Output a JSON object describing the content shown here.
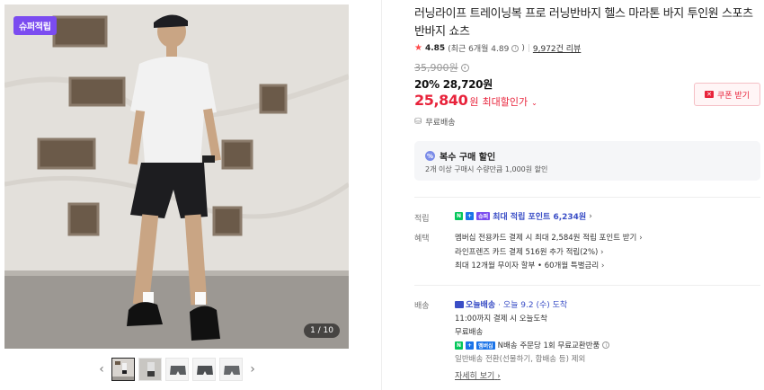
{
  "gallery": {
    "badge": "슈퍼적립",
    "counter": "1 / 10",
    "prev_icon": "chevron-left-icon",
    "next_icon": "chevron-right-icon"
  },
  "product": {
    "title": "러닝라이프 트레이닝복 프로 러닝반바지 헬스 마라톤 바지 투인원 스포츠 반바지 쇼츠",
    "rating": "4.85",
    "rating_detail": "(최근 6개월 4.89",
    "rating_detail_close": ")",
    "review_count": "9,972건 리뷰"
  },
  "price": {
    "original": "35,900원",
    "discount_rate": "20%",
    "sale_price": "28,720원",
    "max_price": "25,840",
    "max_unit": "원",
    "max_label": "최대할인가",
    "coupon_button": "쿠폰 받기",
    "shipping": "무료배송"
  },
  "multi_buy": {
    "title": "복수 구매 할인",
    "desc": "2개 이상 구매시 수량만큼 1,000원 할인"
  },
  "points": {
    "label": "적립",
    "npay_n": "N",
    "npay_plus": "+",
    "npay_super": "슈퍼",
    "text": "최대 적립 포인트 6,234원"
  },
  "benefits": {
    "label": "혜택",
    "lines": [
      "멤버십 전용카드 결제 시 최대 2,584원 적립 포인트 받기",
      "라인프렌즈 카드 결제 516원 추가 적립(2%)",
      "최대 12개월 무이자 할부 • 60개월 특별금리"
    ]
  },
  "delivery": {
    "label": "배송",
    "today_badge": "오늘배송",
    "date_text": "· 오늘 9.2 (수) 도착",
    "cutoff": "11:00까지 결제 시 오늘도착",
    "free": "무료배송",
    "npay_n": "N",
    "npay_plus": "+",
    "npay_mem": "멤버십",
    "return_text": "N배송 주문당 1회 무료교환반품",
    "exclude_text": "일반배송 전환(선물하기, 합배송 등) 제외",
    "detail_link": "자세히 보기"
  },
  "colors": {
    "accent_red": "#e8233b",
    "super_purple": "#7b4cf0",
    "naver_green": "#03c75a",
    "link_blue": "#3a4ec6"
  }
}
